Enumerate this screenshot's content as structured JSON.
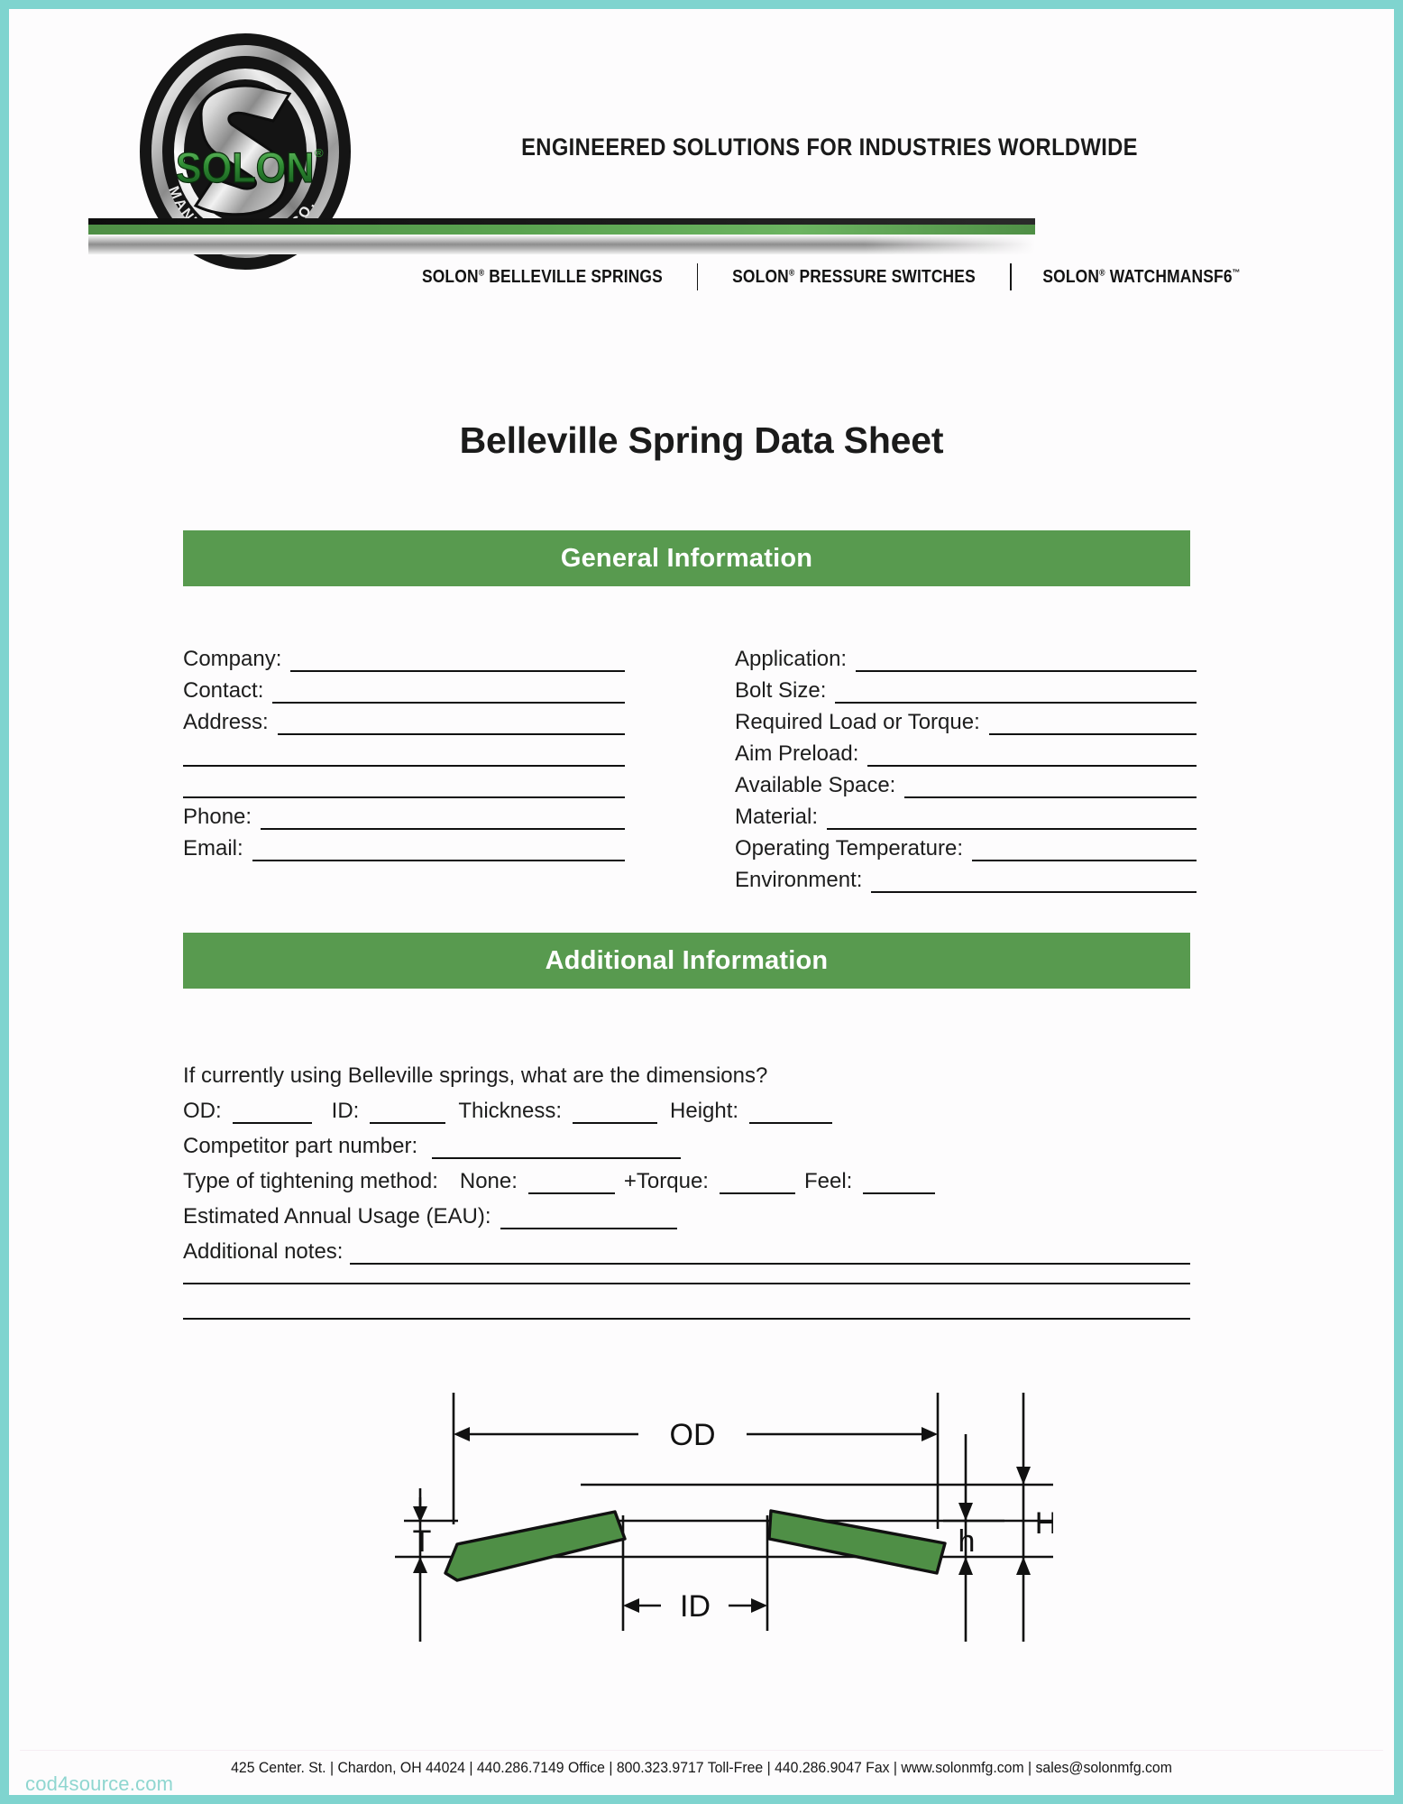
{
  "header": {
    "logo_alt": "solon-manufacturing-co-logo",
    "logo_wordmark": "SOLON",
    "logo_arc_text": "MANUFACTURING CO.",
    "tagline": "ENGINEERED SOLUTIONS FOR INDUSTRIES WORLDWIDE",
    "products": [
      {
        "brand": "SOLON",
        "mark": "®",
        "name": "BELLEVILLE SPRINGS"
      },
      {
        "brand": "SOLON",
        "mark": "®",
        "name": "PRESSURE SWITCHES"
      },
      {
        "brand": "SOLON",
        "mark": "®",
        "name": "WATCHMANSF6",
        "mark2": "™"
      }
    ]
  },
  "doc": {
    "title": "Belleville Spring Data Sheet"
  },
  "sections": {
    "general": {
      "heading": "General Information"
    },
    "additional": {
      "heading": "Additional Information"
    }
  },
  "general_left": [
    {
      "label": "Company:"
    },
    {
      "label": "Contact:"
    },
    {
      "label": "Address:"
    },
    {
      "label": ""
    },
    {
      "label": ""
    },
    {
      "label": "Phone:"
    },
    {
      "label": "Email:"
    }
  ],
  "general_right": [
    {
      "label": "Application:"
    },
    {
      "label": "Bolt Size:"
    },
    {
      "label": "Required Load or Torque:"
    },
    {
      "label": "Aim Preload:"
    },
    {
      "label": "Available Space:"
    },
    {
      "label": "Material:"
    },
    {
      "label": "Operating Temperature:"
    },
    {
      "label": "Environment:"
    }
  ],
  "additional": {
    "prompt": "If currently using Belleville springs,  what are the dimensions?",
    "dims": [
      {
        "label": "OD:"
      },
      {
        "label": "ID:"
      },
      {
        "label": "Thickness:"
      },
      {
        "label": "Height:"
      }
    ],
    "competitor_label": "Competitor part number:",
    "tightening_label": "Type of tightening method:",
    "tightening_options": [
      {
        "label": "None:"
      },
      {
        "label": "+Torque:"
      },
      {
        "label": "Feel:"
      }
    ],
    "eau_label": "Estimated Annual Usage (EAU):",
    "notes_label": "Additional notes:"
  },
  "diagram": {
    "name": "belleville-spring-dimensions-diagram",
    "labels": {
      "od": "OD",
      "id": "ID",
      "t": "T",
      "h_total": "H",
      "h_cone": "h"
    },
    "spring_color": "#4f8f46"
  },
  "footer": {
    "address": "425 Center. St.",
    "city": "Chardon, OH 44024",
    "office": "440.286.7149 Office",
    "tollfree": "800.323.9717 Toll-Free",
    "fax": "440.286.9047 Fax",
    "website": "www.solonmfg.com",
    "email": "sales@solonmfg.com",
    "line": "425 Center. St.  |  Chardon, OH 44024  |  440.286.7149 Office  |  800.323.9717 Toll-Free  |  440.286.9047 Fax  |  www.solonmfg.com  |  sales@solonmfg.com"
  },
  "watermark": {
    "text": "cod4source.com"
  },
  "colors": {
    "section_green": "#589a4f",
    "bar_green": "#5aa350",
    "frame_teal": "#7fd4cf",
    "watermark_teal": "#8fd6d0",
    "logo_green": "#3f9b41"
  }
}
